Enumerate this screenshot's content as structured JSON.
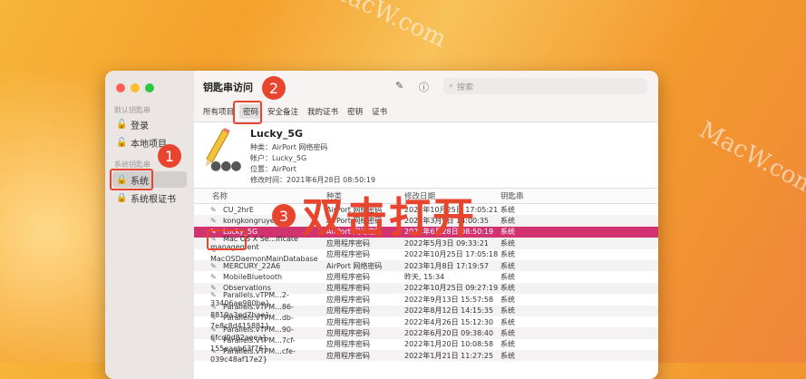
{
  "window": {
    "title": "钥匙串访问",
    "search_placeholder": "搜索"
  },
  "sidebar": {
    "default_header": "默认钥匙串",
    "default_items": [
      {
        "label": "登录"
      },
      {
        "label": "本地项目"
      }
    ],
    "system_header": "系统钥匙串",
    "system_items": [
      {
        "label": "系统"
      },
      {
        "label": "系统根证书"
      }
    ]
  },
  "tabs": [
    {
      "label": "所有项目"
    },
    {
      "label": "密码"
    },
    {
      "label": "安全备注"
    },
    {
      "label": "我的证书"
    },
    {
      "label": "密钥"
    },
    {
      "label": "证书"
    }
  ],
  "detail": {
    "name": "Lucky_5G",
    "kind": "种类：AirPort 网络密码",
    "account": "帐户：Lucky_5G",
    "where": "位置：AirPort",
    "modified": "修改时间：2021年6月28日 08:50:19"
  },
  "table": {
    "headers": [
      "名称",
      "种类",
      "修改日期",
      "钥匙串"
    ],
    "rows": [
      [
        "CU_2hrE",
        "AirPort 网络密码",
        "2022年10月25日 17:05:21",
        "系统"
      ],
      [
        "kongkongruye",
        "AirPort 网络密码",
        "2022年3月9日 14:00:35",
        "系统"
      ],
      [
        "Lucky_5G",
        "AirPort 网络密码",
        "2021年6月28日 08:50:19",
        "系统"
      ],
      [
        "Mac OS X Se...ificate management",
        "应用程序密码",
        "2022年5月3日 09:33:21",
        "系统"
      ],
      [
        "MacOSDaemonMainDatabase",
        "应用程序密码",
        "2022年10月25日 17:05:18",
        "系统"
      ],
      [
        "MERCURY_22A6",
        "AirPort 网络密码",
        "2023年1月8日 17:19:57",
        "系统"
      ],
      [
        "MobileBluetooth",
        "应用程序密码",
        "昨天, 15:34",
        "系统"
      ],
      [
        "Observations",
        "应用程序密码",
        "2022年10月25日 09:27:19",
        "系统"
      ],
      [
        "Parallels.vTPM...2-33406ae980be}",
        "应用程序密码",
        "2022年9月13日 15:57:58",
        "系统"
      ],
      [
        "Parallels.vTPM...86-8819a3ed7bae}",
        "应用程序密码",
        "2022年8月12日 14:15:35",
        "系统"
      ],
      [
        "Parallels.vTPM...db-7e8c8d415881}",
        "应用程序密码",
        "2022年4月26日 15:12:30",
        "系统"
      ],
      [
        "Parallels.vTPM...90-6fcd9d82aeea}",
        "应用程序密码",
        "2022年6月20日 09:38:40",
        "系统"
      ],
      [
        "Parallels.vTPM...7cf-155eaeb63f76}",
        "应用程序密码",
        "2022年1月20日 10:08:58",
        "系统"
      ],
      [
        "Parallels.vTPM...cfe-039c48af17e2}",
        "应用程序密码",
        "2022年1月21日 11:27:25",
        "系统"
      ]
    ],
    "selected_index": 2
  },
  "annotations": {
    "step1": "1",
    "step2": "2",
    "step3": "3",
    "instruction": "双击打开"
  },
  "watermark": "MacW.com"
}
